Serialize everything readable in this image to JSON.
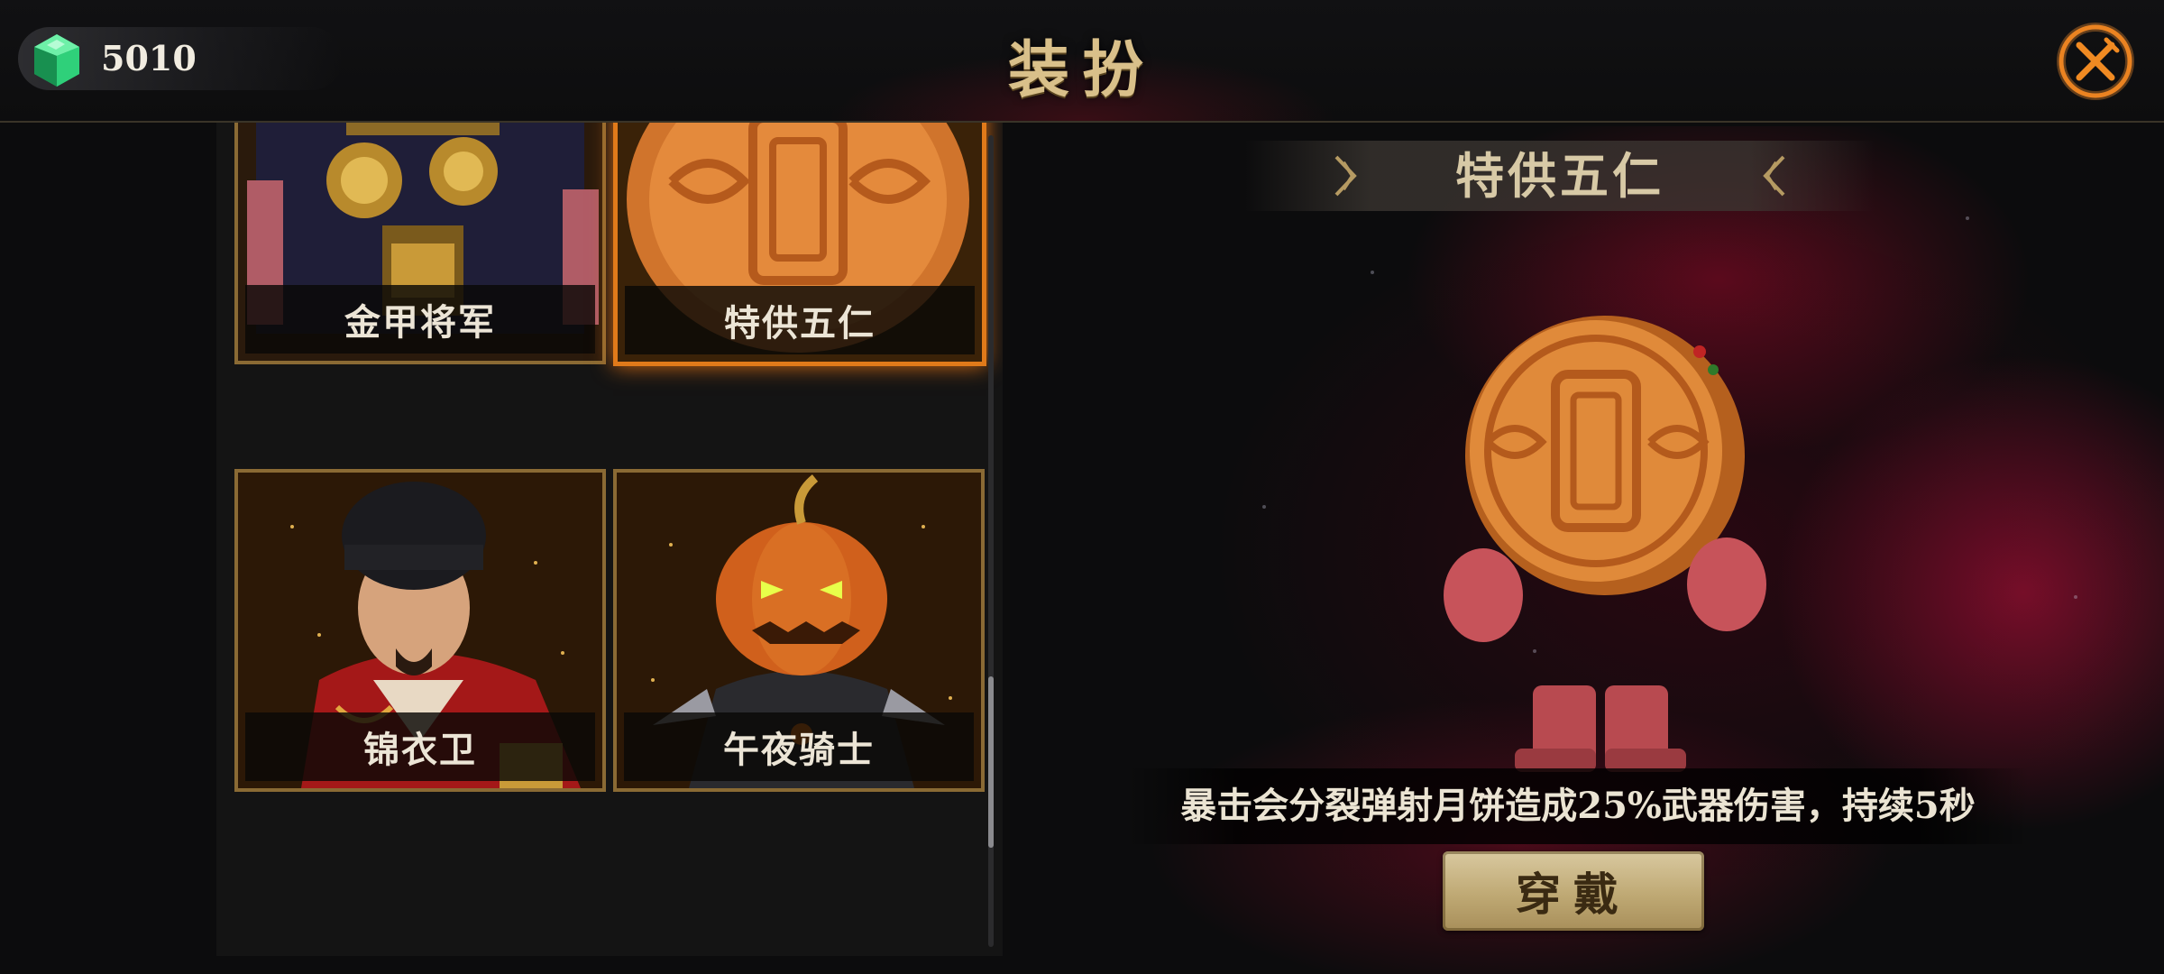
{
  "header": {
    "currency_amount": "5010",
    "title": "装扮",
    "close_icon": "close-x-icon"
  },
  "skins": [
    {
      "name": "金甲将军",
      "selected": false
    },
    {
      "name": "特供五仁",
      "selected": true
    },
    {
      "name": "锦衣卫",
      "selected": false
    },
    {
      "name": "午夜骑士",
      "selected": false
    }
  ],
  "detail": {
    "name": "特供五仁",
    "description": "暴击会分裂弹射月饼造成25%武器伤害，持续5秒",
    "equip_label": "穿戴"
  },
  "colors": {
    "accent_gold": "#d9c08a",
    "selected_border": "#e07a1a",
    "gem_green": "#2fd07a"
  }
}
